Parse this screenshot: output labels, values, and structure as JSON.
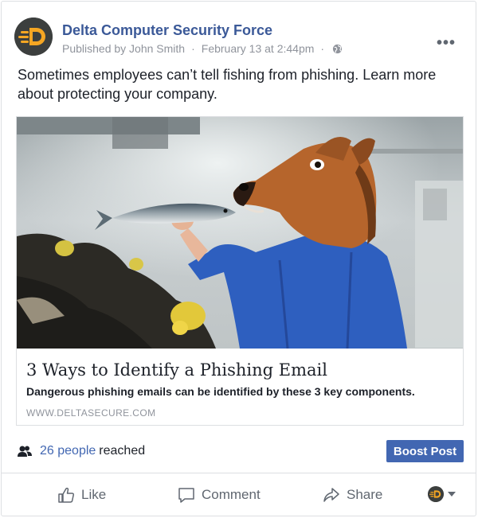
{
  "post": {
    "page_name": "Delta Computer Security Force",
    "published_by": "Published by John Smith",
    "date": "February 13 at 2:44pm",
    "separator": "·",
    "text": "Sometimes employees can’t tell fishing from phishing. Learn more about protecting your company."
  },
  "link_preview": {
    "title": "3 Ways to Identify a Phishing Email",
    "description": "Dangerous phishing emails can be identified by these 3 key components.",
    "domain": "WWW.DELTASECURE.COM"
  },
  "reach": {
    "count": "26 people",
    "label": "reached",
    "boost_label": "Boost Post"
  },
  "actions": {
    "like": "Like",
    "comment": "Comment",
    "share": "Share"
  },
  "icons": {
    "avatar": "delta-logo-icon",
    "privacy": "globe-icon",
    "more": "more-options-icon",
    "reach": "people-icon",
    "like": "thumbs-up-icon",
    "comment": "comment-bubble-icon",
    "share": "share-arrow-icon",
    "actor": "actor-switch-icon"
  },
  "colors": {
    "brand_blue": "#3b5998",
    "button_blue": "#4267b2",
    "logo_orange": "#f5a623",
    "muted_gray": "#90949c"
  }
}
